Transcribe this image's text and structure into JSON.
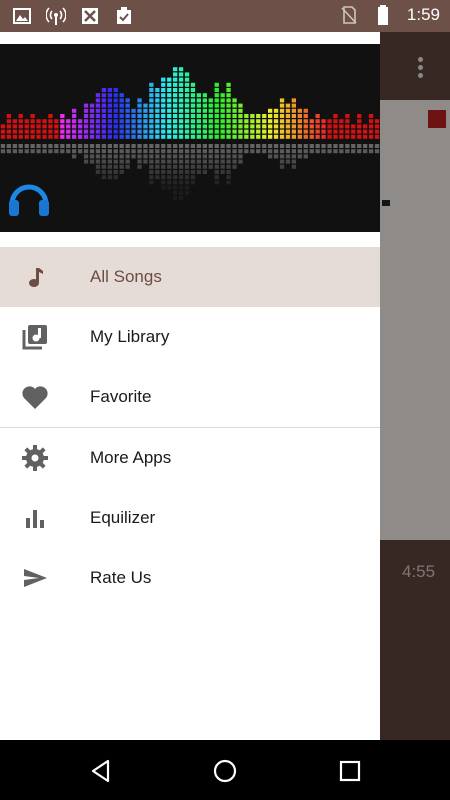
{
  "status_bar": {
    "time": "1:59",
    "icons": [
      "image-icon",
      "wifi-hotspot-icon",
      "app-icon",
      "clipboard-check-icon",
      "no-sim-icon",
      "battery-icon"
    ]
  },
  "background_app": {
    "duration": "4:55"
  },
  "drawer": {
    "header_image": "equalizer-banner-with-headphones",
    "items": [
      {
        "label": "All Songs",
        "icon": "music-note-icon",
        "active": true
      },
      {
        "label": "My Library",
        "icon": "library-music-icon",
        "active": false
      },
      {
        "label": "Favorite",
        "icon": "heart-icon",
        "active": false
      },
      {
        "label": "More Apps",
        "icon": "gear-icon",
        "active": false
      },
      {
        "label": "Equilizer",
        "icon": "bar-chart-icon",
        "active": false
      },
      {
        "label": "Rate Us",
        "icon": "send-icon",
        "active": false
      }
    ]
  },
  "nav_bar": {
    "buttons": [
      "back-icon",
      "home-icon",
      "recents-icon"
    ]
  },
  "colors": {
    "status_bar": "#6d5048",
    "app_bg": "#5b423b",
    "active_item_bg": "#e5dcd8",
    "active_item_text": "#6d4c41",
    "icon_gray": "#616161"
  }
}
